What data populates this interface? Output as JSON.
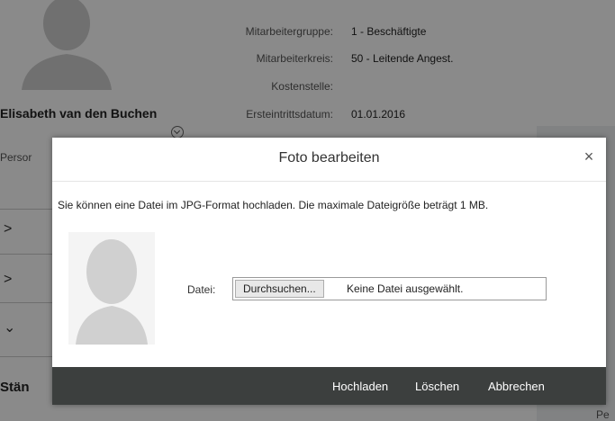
{
  "background": {
    "employee_name": "Elisabeth van den Buchen",
    "fields": [
      {
        "label": "Mitarbeitergruppe:",
        "value": "1 - Beschäftigte"
      },
      {
        "label": "Mitarbeiterkreis:",
        "value": "50 - Leitende Angest."
      },
      {
        "label": "Kostenstelle:",
        "value": ""
      },
      {
        "label": "Ersteintrittsdatum:",
        "value": "01.01.2016"
      }
    ],
    "person_label": "Persor",
    "bottom_title": "Stän",
    "right_edge_text": "Pe"
  },
  "dialog": {
    "title": "Foto bearbeiten",
    "close_icon": "×",
    "info": "Sie können eine Datei im JPG-Format hochladen. Die maximale Dateigröße beträgt 1 MB.",
    "file_label": "Datei:",
    "browse_button": "Durchsuchen...",
    "file_status": "Keine Datei ausgewählt.",
    "buttons": {
      "upload": "Hochladen",
      "delete": "Löschen",
      "cancel": "Abbrechen"
    }
  },
  "colors": {
    "footer_bg": "#3c3f3e",
    "overlay": "rgba(0,0,0,0.46)"
  }
}
